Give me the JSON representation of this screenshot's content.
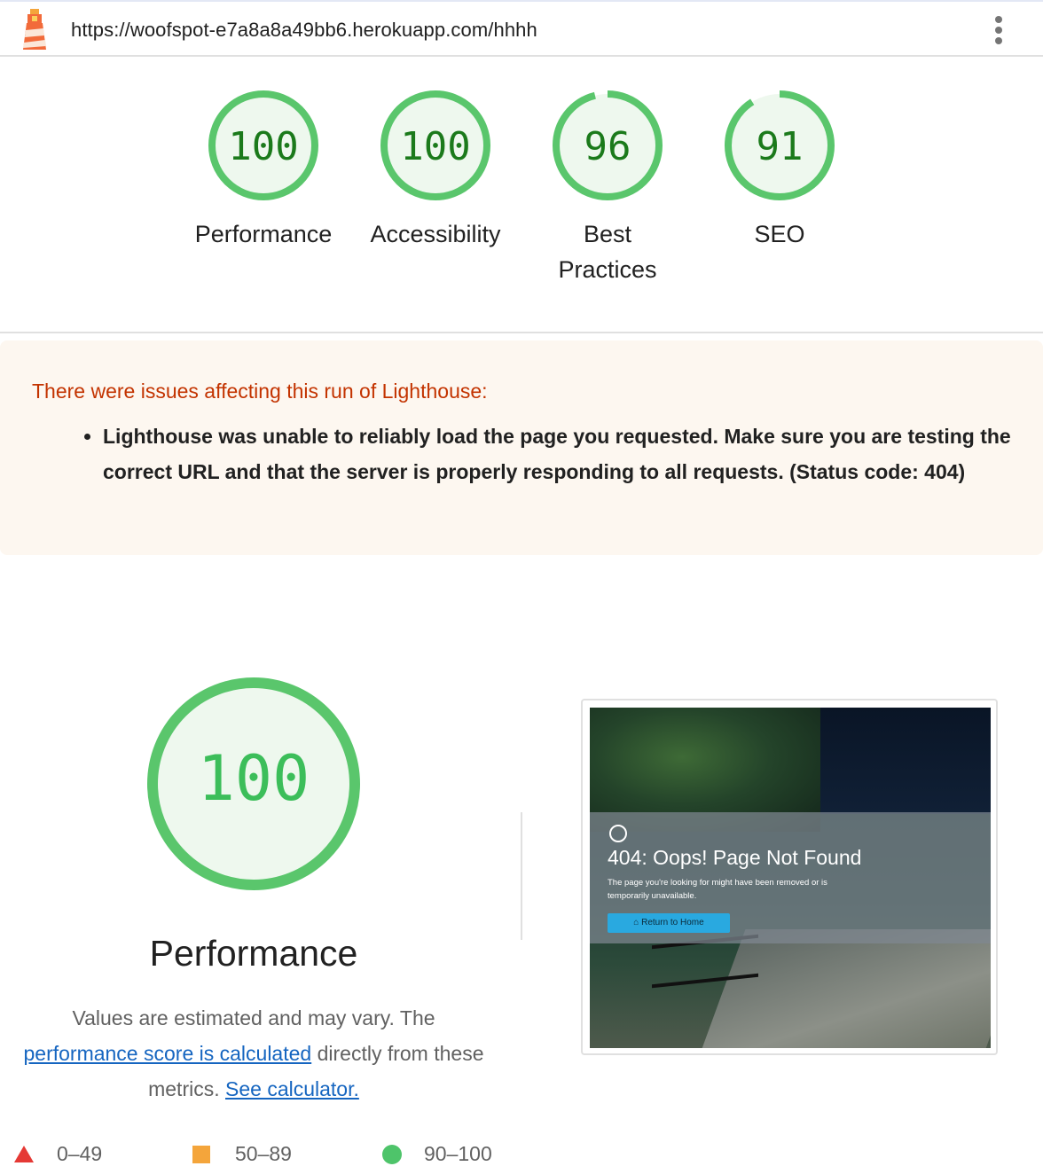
{
  "header": {
    "url": "https://woofspot-e7a8a8a49bb6.herokuapp.com/hhhh",
    "logo_icon": "lighthouse-icon",
    "menu_icon": "kebab-menu-icon"
  },
  "categories": [
    {
      "score": "100",
      "value": 100,
      "label_lines": [
        "Performance"
      ]
    },
    {
      "score": "100",
      "value": 100,
      "label_lines": [
        "Accessibility"
      ]
    },
    {
      "score": "96",
      "value": 96,
      "label_lines": [
        "Best",
        "Practices"
      ]
    },
    {
      "score": "91",
      "value": 91,
      "label_lines": [
        "SEO"
      ]
    }
  ],
  "warning": {
    "title": "There were issues affecting this run of Lighthouse:",
    "items": [
      "Lighthouse was unable to reliably load the page you requested. Make sure you are testing the correct URL and that the server is properly responding to all requests. (Status code: 404)"
    ]
  },
  "performance": {
    "score": "100",
    "value": 100,
    "title": "Performance",
    "desc_part1": "Values are estimated and may vary. The",
    "desc_link1": "performance score is calculated",
    "desc_part2": "directly from these metrics.",
    "desc_link2": "See calculator."
  },
  "screenshot": {
    "heading": "404: Oops! Page Not Found",
    "text": "The page you're looking for might have been removed or is temporarily unavailable.",
    "button": "Return to Home"
  },
  "legend": {
    "fail": "0–49",
    "average": "50–89",
    "pass": "90–100"
  },
  "colors": {
    "pass": "#0cce6b",
    "pass_fill": "#eef8ee",
    "pass_text": "#1b7a1b",
    "average": "#f4a53b",
    "fail": "#e53935",
    "warning_title": "#c33300",
    "warning_bg": "#fdf7f0",
    "link": "#1565c0"
  }
}
